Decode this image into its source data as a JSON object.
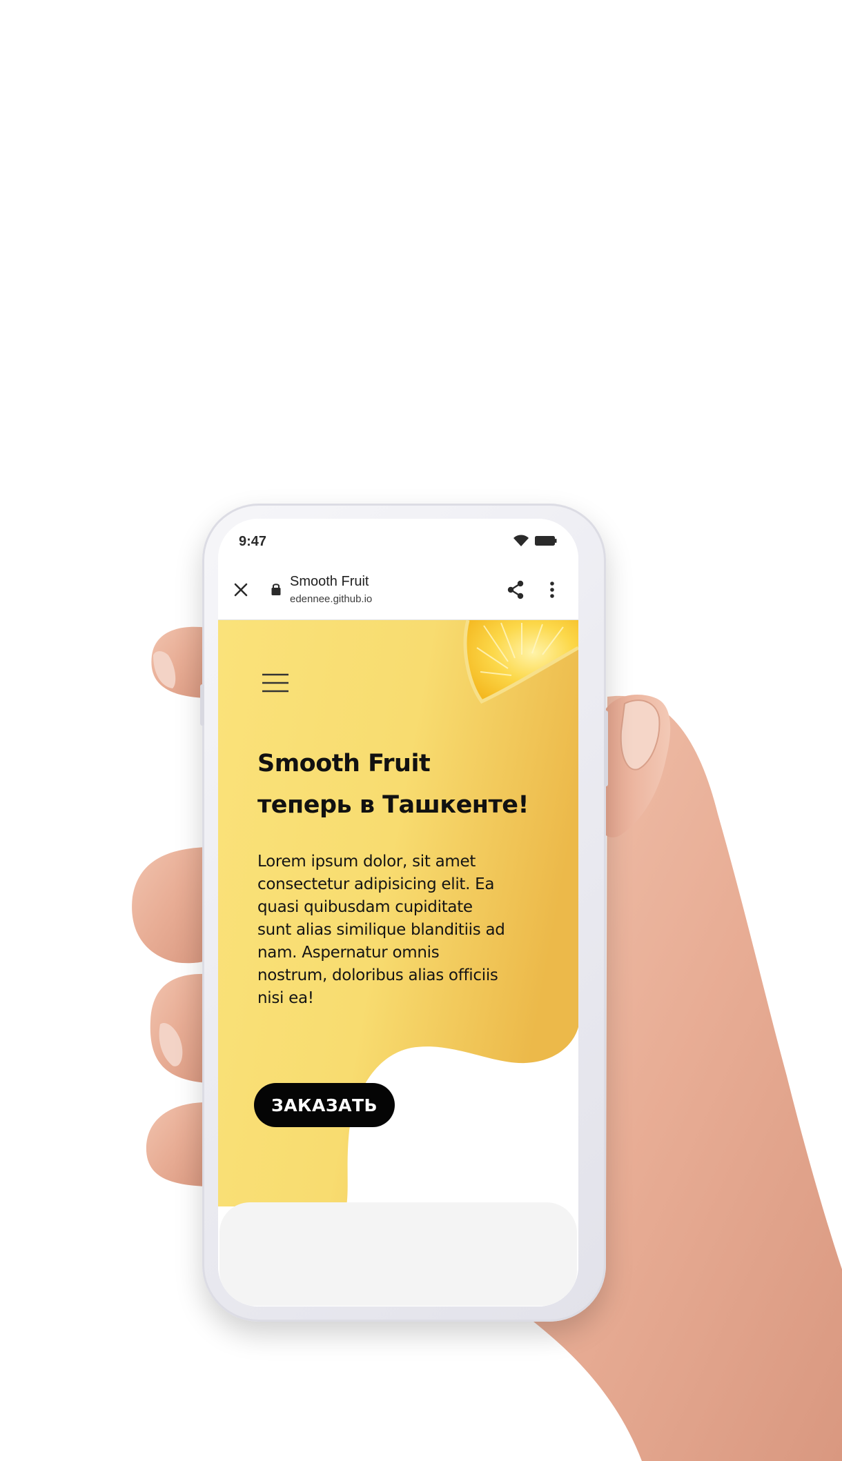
{
  "status_bar": {
    "time": "9:47",
    "wifi_icon": "wifi-icon",
    "battery_icon": "battery-icon"
  },
  "browser_bar": {
    "close_icon": "close-icon",
    "lock_icon": "lock-icon",
    "title": "Smooth Fruit",
    "url": "edennee.github.io",
    "share_icon": "share-icon",
    "more_icon": "more-vertical-icon"
  },
  "page": {
    "menu_icon": "hamburger-menu-icon",
    "hero_title_line1": "Smooth Fruit",
    "hero_title_line2": "теперь в Ташкенте!",
    "hero_text": "Lorem ipsum dolor, sit amet consectetur adipisicing elit. Ea quasi quibusdam cupiditate sunt alias similique blanditiis ad nam. Aspernatur omnis nostrum, doloribus alias officiis nisi ea!",
    "order_button": "ЗАКАЗАТЬ",
    "lemon_image": "lemon-slice-image"
  },
  "colors": {
    "hero_yellow_light": "#fae27a",
    "hero_yellow_dark": "#ecb94a",
    "button_bg": "#050505",
    "button_text": "#ffffff"
  }
}
